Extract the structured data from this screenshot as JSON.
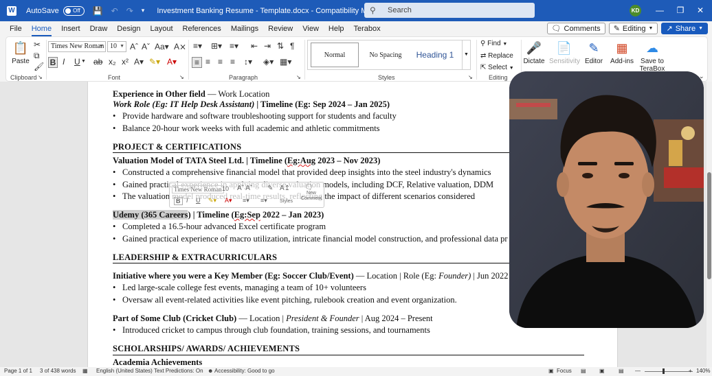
{
  "titlebar": {
    "autosave_label": "AutoSave",
    "autosave_state": "Off",
    "doc_title": "Investment Banking Resume - Template.docx  -  Compatibility Mode  •  Saved",
    "search_placeholder": "Search",
    "avatar_initials": "KD"
  },
  "menu": {
    "tabs": [
      "File",
      "Home",
      "Insert",
      "Draw",
      "Design",
      "Layout",
      "References",
      "Mailings",
      "Review",
      "View",
      "Help",
      "Terabox"
    ],
    "active_tab": "Home",
    "comments_label": "Comments",
    "editing_label": "Editing",
    "share_label": "Share"
  },
  "ribbon": {
    "clipboard": {
      "paste": "Paste",
      "label": "Clipboard"
    },
    "font": {
      "name": "Times New Roman",
      "size": "10",
      "label": "Font"
    },
    "paragraph": {
      "label": "Paragraph"
    },
    "styles": {
      "normal": "Normal",
      "no_spacing": "No Spacing",
      "heading1": "Heading 1",
      "label": "Styles"
    },
    "editing": {
      "find": "Find",
      "replace": "Replace",
      "select": "Select",
      "label": "Editing"
    },
    "voice": {
      "dictate": "Dictate"
    },
    "sensitivity": {
      "label": "Sensitivity"
    },
    "editor": {
      "label": "Editor"
    },
    "addins": {
      "label": "Add-ins"
    },
    "terabox": {
      "line1": "Save to",
      "line2": "TeraBox"
    }
  },
  "document": {
    "exp_head_bold": "Experience in Other field",
    "exp_head_rest": " — Work Location",
    "exp_role_italic": "Work Role (Eg: IT Help Desk Assistant)",
    "exp_role_rest": " | Timeline (Eg: Sep 2024 – Jan 2025)",
    "exp_b1": "Provide hardware and software troubleshooting support for students and faculty",
    "exp_b2": "Balance 20-hour work weeks with full academic and athletic commitments",
    "proj_heading": "PROJECT & CERTIFICATIONS",
    "proj1_title_a": "Valuation Model of TATA Steel Ltd. | Timeline (",
    "proj1_title_eg": "Eg:Aug",
    "proj1_title_b": " 2023 – Nov 2023)",
    "proj1_b1": "Constructed a comprehensive financial model that provided deep insights into the steel industry's dynamics",
    "proj1_b2": "Gained practical experience in applying diverse valuation models, including DCF, Relative valuation, DDM",
    "proj1_b3": "The valuation model produced real-time results, reflecting the impact of different scenarios considered",
    "proj2_title_sel": "Udemy (365 Careers",
    "proj2_title_a": ") | Timeline (",
    "proj2_title_eg": "Eg:Sep",
    "proj2_title_b": " 2022 – Jan 2023)",
    "proj2_b1": "Completed a 16.5-hour advanced Excel certificate program",
    "proj2_b2": "Gained practical experience of macro utilization, intricate financial model construction, and professional data pr",
    "lead_heading": "LEADERSHIP & EXTRACURRICULARS",
    "lead1_bold": "Initiative where you were a Key Member (Eg: Soccer Club/Event)",
    "lead1_rest_a": " — Location | Role (Eg: ",
    "lead1_italic": "Founder)",
    "lead1_rest_b": " | Jun 2022",
    "lead1_b1": "Led large-scale college fest events, managing a team of 10+ volunteers",
    "lead1_b2": "Oversaw all event-related activities like event pitching, rulebook creation and event organization.",
    "lead2_bold": "Part of Some Club (Cricket Club)",
    "lead2_rest_a": " — Location | ",
    "lead2_italic": "President & Founder",
    "lead2_rest_b": " | Aug 2024 – Present",
    "lead2_b1": "Introduced cricket to campus through club foundation, training sessions, and tournaments",
    "schol_heading": "SCHOLARSHIPS/ AWARDS/ ACHIEVEMENTS",
    "schol_sub": "Academia Achievements"
  },
  "minitoolbar": {
    "font": "Times New Roman",
    "size": "10",
    "styles": "Styles",
    "comment": "New Comment"
  },
  "statusbar": {
    "page": "Page 1 of 1",
    "words": "3 of 438 words",
    "language": "English (United States)",
    "predictions": "Text Predictions: On",
    "accessibility": "Accessibility: Good to go",
    "focus": "Focus",
    "zoom": "140%"
  },
  "colors": {
    "titlebar": "#1e5bb8",
    "accent": "#185abd",
    "heading1": "#2f5496"
  }
}
